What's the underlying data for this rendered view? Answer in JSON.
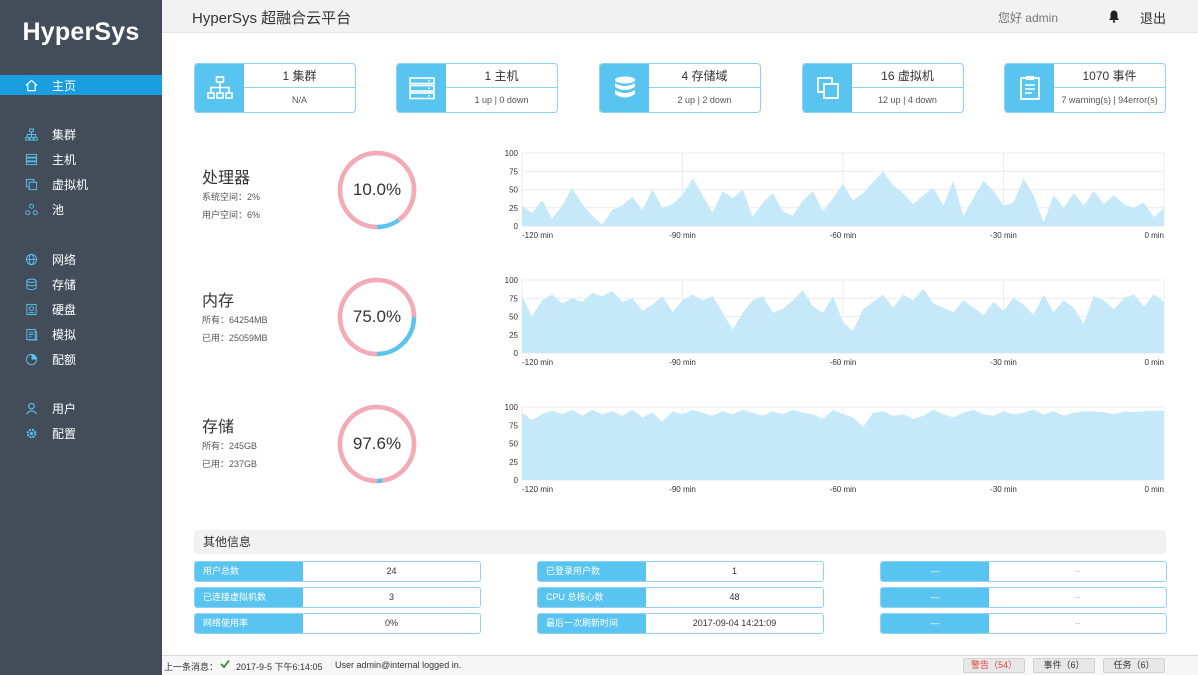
{
  "sidebar": {
    "brand": "HyperSys",
    "items": [
      {
        "label": "主页",
        "icon": "home-icon"
      },
      {
        "label": "集群",
        "icon": "cluster-icon"
      },
      {
        "label": "主机",
        "icon": "server-icon"
      },
      {
        "label": "虚拟机",
        "icon": "vm-icon"
      },
      {
        "label": "池",
        "icon": "pool-icon"
      },
      {
        "label": "网络",
        "icon": "globe-icon"
      },
      {
        "label": "存储",
        "icon": "database-icon"
      },
      {
        "label": "硬盘",
        "icon": "disk-icon"
      },
      {
        "label": "模拟",
        "icon": "template-icon"
      },
      {
        "label": "配额",
        "icon": "pie-icon"
      },
      {
        "label": "用户",
        "icon": "user-icon"
      },
      {
        "label": "配置",
        "icon": "gear-icon"
      }
    ]
  },
  "header": {
    "title": "HyperSys 超融合云平台",
    "greeting": "您好 admin",
    "logout": "退出"
  },
  "cards": [
    {
      "title": "1 集群",
      "sub": "N/A",
      "icon": "cluster-icon"
    },
    {
      "title": "1 主机",
      "sub": "1 up | 0 down",
      "icon": "server-icon"
    },
    {
      "title": "4 存储域",
      "sub": "2 up | 2 down",
      "icon": "database-icon"
    },
    {
      "title": "16 虚拟机",
      "sub": "12 up | 4 down",
      "icon": "vm-icon"
    },
    {
      "title": "1070 事件",
      "sub": "7 warning(s) | 94error(s)",
      "icon": "clipboard-icon"
    }
  ],
  "resources": {
    "cpu": {
      "title": "处理器",
      "line1": "系统空间：2%",
      "line2": "用户空间：6%",
      "gauge_text": "10.0%",
      "used_fraction": 0.9
    },
    "memory": {
      "title": "内存",
      "line1": "所有：64254MB",
      "line2": "已用：25059MB",
      "gauge_text": "75.0%",
      "used_fraction": 0.75
    },
    "storage": {
      "title": "存储",
      "line1": "所有：245GB",
      "line2": "已用：237GB",
      "gauge_text": "97.6%",
      "used_fraction": 0.976
    }
  },
  "chart_data": [
    {
      "type": "area",
      "x_ticks": [
        "-120 min",
        "-90 min",
        "-60 min",
        "-30 min",
        "0 min"
      ],
      "y_ticks": [
        "0",
        "25",
        "50",
        "75",
        "100"
      ],
      "ylim": [
        0,
        100
      ],
      "xlim": [
        -120,
        0
      ],
      "grid": true,
      "y": [
        28,
        18,
        35,
        10,
        28,
        52,
        30,
        14,
        2,
        22,
        28,
        40,
        22,
        50,
        25,
        30,
        42,
        65,
        42,
        18,
        48,
        38,
        50,
        12,
        32,
        45,
        20,
        14,
        35,
        48,
        20,
        38,
        58,
        35,
        45,
        60,
        75,
        55,
        45,
        30,
        42,
        52,
        28,
        62,
        14,
        38,
        62,
        48,
        28,
        32,
        65,
        42,
        5,
        42,
        25,
        45,
        28,
        48,
        30,
        42,
        30,
        25,
        32,
        12,
        25
      ]
    },
    {
      "type": "area",
      "x_ticks": [
        "-120 min",
        "-90 min",
        "-60 min",
        "-30 min",
        "0 min"
      ],
      "y_ticks": [
        "0",
        "25",
        "50",
        "75",
        "100"
      ],
      "ylim": [
        0,
        100
      ],
      "xlim": [
        -120,
        0
      ],
      "grid": true,
      "y": [
        78,
        50,
        72,
        80,
        68,
        75,
        70,
        82,
        78,
        85,
        70,
        75,
        58,
        66,
        78,
        56,
        72,
        80,
        72,
        78,
        55,
        32,
        55,
        72,
        78,
        55,
        60,
        72,
        86,
        64,
        55,
        78,
        42,
        30,
        60,
        70,
        80,
        62,
        80,
        72,
        88,
        68,
        62,
        56,
        72,
        62,
        52,
        70,
        58,
        76,
        66,
        52,
        80,
        56,
        72,
        62,
        40,
        78,
        72,
        60,
        75,
        80,
        64,
        80,
        70
      ]
    },
    {
      "type": "area",
      "x_ticks": [
        "-120 min",
        "-90 min",
        "-60 min",
        "-30 min",
        "0 min"
      ],
      "y_ticks": [
        "0",
        "25",
        "50",
        "75",
        "100"
      ],
      "ylim": [
        0,
        100
      ],
      "xlim": [
        -120,
        0
      ],
      "grid": true,
      "y": [
        92,
        82,
        90,
        95,
        90,
        96,
        88,
        96,
        90,
        94,
        88,
        96,
        86,
        92,
        80,
        94,
        90,
        96,
        92,
        88,
        94,
        90,
        96,
        92,
        88,
        94,
        90,
        96,
        92,
        90,
        84,
        96,
        90,
        86,
        72,
        92,
        94,
        88,
        90,
        84,
        88,
        96,
        90,
        86,
        92,
        96,
        90,
        88,
        94,
        90,
        92,
        96,
        90,
        94,
        88,
        92,
        94,
        94,
        93,
        90,
        94,
        93,
        94,
        95,
        95
      ]
    }
  ],
  "other_info": {
    "title": "其他信息",
    "rows": [
      [
        {
          "label": "用户总数",
          "value": "24"
        },
        {
          "label": "已登录用户数",
          "value": "1"
        },
        {
          "label": "—",
          "value": "--"
        }
      ],
      [
        {
          "label": "已连接虚拟机数",
          "value": "3"
        },
        {
          "label": "CPU 总核心数",
          "value": "48"
        },
        {
          "label": "—",
          "value": "--"
        }
      ],
      [
        {
          "label": "网络使用率",
          "value": "0%"
        },
        {
          "label": "最后一次刷新时间",
          "value": "2017-09-04 14:21:09"
        },
        {
          "label": "—",
          "value": "--"
        }
      ]
    ]
  },
  "statusbar": {
    "label": "上一条消息：",
    "time": "2017-9-5 下午6:14:05",
    "message": "User admin@internal logged in.",
    "warnings": "警告（54）",
    "events": "事件（6）",
    "tasks": "任务（6）"
  },
  "colors": {
    "sidebar_bg": "#434d5a",
    "active_nav": "#1a9ee0",
    "accent": "#5ac4f1",
    "area_fill": "#c5e9f9",
    "gauge_free": "#5ac4f1",
    "gauge_used": "#f7aab6",
    "warning": "#e0453a"
  }
}
